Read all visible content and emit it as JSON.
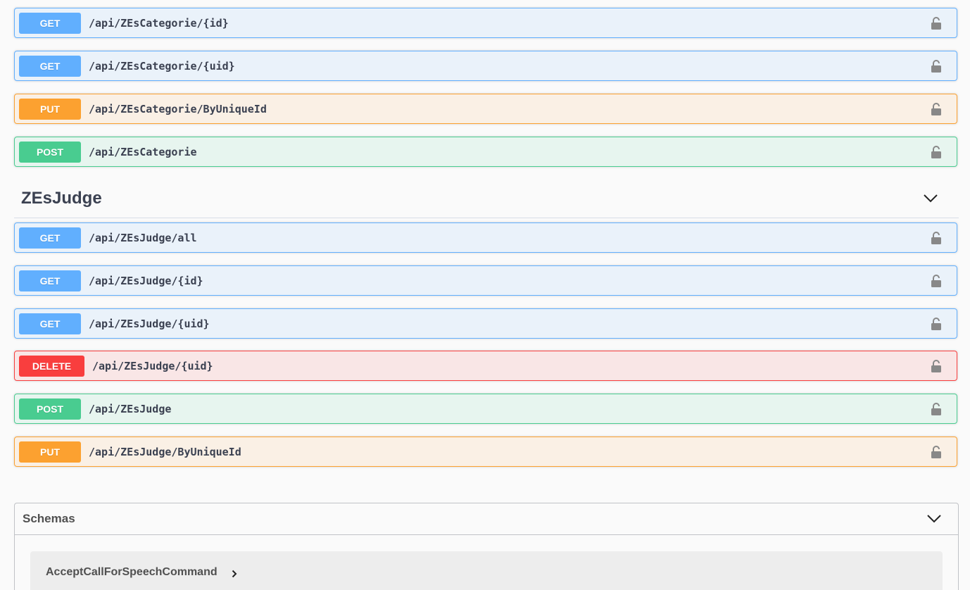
{
  "top_operations": [
    {
      "method": "GET",
      "path": "/api/ZEsCategorie/{id}",
      "lock_icon": "unlocked-padlock-icon"
    },
    {
      "method": "GET",
      "path": "/api/ZEsCategorie/{uid}",
      "lock_icon": "unlocked-padlock-icon"
    },
    {
      "method": "PUT",
      "path": "/api/ZEsCategorie/ByUniqueId",
      "lock_icon": "unlocked-padlock-icon"
    },
    {
      "method": "POST",
      "path": "/api/ZEsCategorie",
      "lock_icon": "unlocked-padlock-icon"
    }
  ],
  "tag": {
    "title": "ZEsJudge",
    "toggle_icon": "chevron-down-icon"
  },
  "judge_operations": [
    {
      "method": "GET",
      "path": "/api/ZEsJudge/all",
      "lock_icon": "unlocked-padlock-icon"
    },
    {
      "method": "GET",
      "path": "/api/ZEsJudge/{id}",
      "lock_icon": "unlocked-padlock-icon"
    },
    {
      "method": "GET",
      "path": "/api/ZEsJudge/{uid}",
      "lock_icon": "unlocked-padlock-icon"
    },
    {
      "method": "DELETE",
      "path": "/api/ZEsJudge/{uid}",
      "lock_icon": "unlocked-padlock-icon"
    },
    {
      "method": "POST",
      "path": "/api/ZEsJudge",
      "lock_icon": "unlocked-padlock-icon"
    },
    {
      "method": "PUT",
      "path": "/api/ZEsJudge/ByUniqueId",
      "lock_icon": "unlocked-padlock-icon"
    }
  ],
  "schemas": {
    "title": "Schemas",
    "toggle_icon": "chevron-down-icon",
    "models": [
      {
        "name": "AcceptCallForSpeechCommand",
        "expand_icon": "chevron-right-icon"
      }
    ]
  },
  "colors": {
    "get": "#61affe",
    "put": "#fca130",
    "post": "#49cc90",
    "delete": "#f93e3e",
    "text": "#3b4151"
  }
}
